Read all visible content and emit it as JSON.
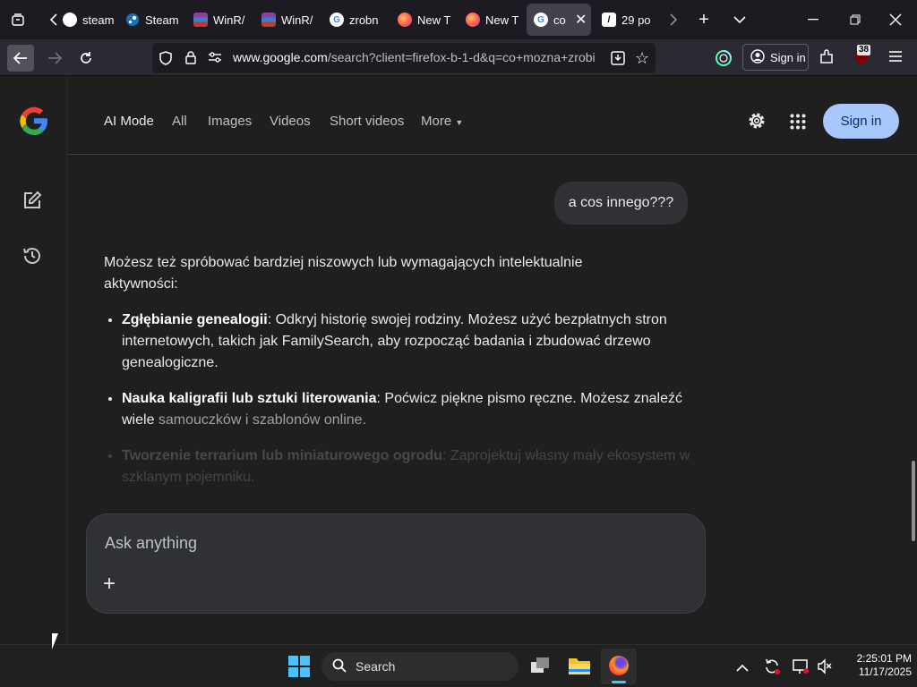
{
  "browser": {
    "tabs": [
      {
        "label": "steam",
        "icon": "steam-icon"
      },
      {
        "label": "Steam",
        "icon": "steam-icon"
      },
      {
        "label": "WinR/",
        "icon": "winrar-icon"
      },
      {
        "label": "WinR/",
        "icon": "winrar-icon"
      },
      {
        "label": "zrobn",
        "icon": "google-icon"
      },
      {
        "label": "New T",
        "icon": "firefox-icon"
      },
      {
        "label": "New T",
        "icon": "firefox-icon"
      },
      {
        "label": "co",
        "icon": "google-icon",
        "active": true
      },
      {
        "label": "29 po",
        "icon": "site-icon"
      }
    ],
    "url_host": "www.google.com",
    "url_path": "/search?client=firefox-b-1-d&q=co+mozna+zrobi",
    "account_label": "Sign in",
    "extension_badge": "38"
  },
  "google": {
    "nav": [
      {
        "label": "AI Mode",
        "active": true
      },
      {
        "label": "All"
      },
      {
        "label": "Images"
      },
      {
        "label": "Videos"
      },
      {
        "label": "Short videos"
      },
      {
        "label": "More"
      }
    ],
    "signin_label": "Sign in",
    "brand_color": "#a8c7fa"
  },
  "chat": {
    "user_message": "a cos innego???",
    "intro": "Możesz też spróbować bardziej niszowych lub wymagających intelektualnie aktywności:",
    "items": [
      {
        "title": "Zgłębianie genealogii",
        "text": ": Odkryj historię swojej rodziny. Możesz użyć bezpłatnych stron internetowych, takich jak FamilySearch, aby rozpocząć badania i zbudować drzewo genealogiczne."
      },
      {
        "title": "Nauka kaligrafii lub sztuki literowania",
        "text": ": Poćwicz piękne pismo ręczne. Możesz znaleźć wiele ",
        "faded": "samouczków i szablonów online."
      },
      {
        "title": "Tworzenie terrarium lub miniaturowego ogrodu",
        "text": ": Zaprojektuj własny mały ekosystem w szklanym pojemniku."
      }
    ]
  },
  "ask": {
    "placeholder": "Ask anything",
    "plus_label": "+"
  },
  "taskbar": {
    "search_label": "Search",
    "time": "2:25:01 PM",
    "date": "11/17/2025"
  }
}
